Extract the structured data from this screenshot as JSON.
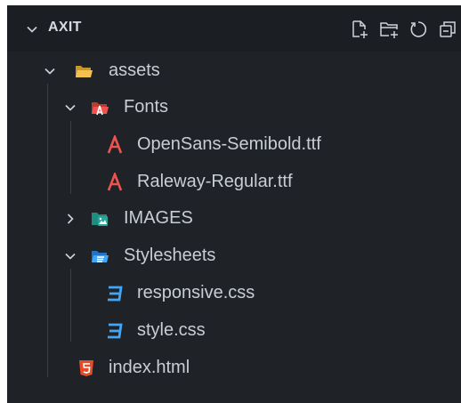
{
  "explorer": {
    "title": "AXIT",
    "actions": [
      {
        "name": "new-file-icon"
      },
      {
        "name": "new-folder-icon"
      },
      {
        "name": "refresh-icon"
      },
      {
        "name": "collapse-all-icon"
      }
    ]
  },
  "tree": {
    "assets": {
      "label": "assets",
      "icon": "folder-open-icon",
      "expanded": true
    },
    "fonts": {
      "label": "Fonts",
      "icon": "font-folder-icon",
      "expanded": true
    },
    "font_file_1": {
      "label": "OpenSans-Semibold.ttf",
      "icon": "font-file-icon"
    },
    "font_file_2": {
      "label": "Raleway-Regular.ttf",
      "icon": "font-file-icon"
    },
    "images": {
      "label": "IMAGES",
      "icon": "image-folder-icon",
      "expanded": false
    },
    "stylesheets": {
      "label": "Stylesheets",
      "icon": "css-folder-icon",
      "expanded": true
    },
    "css_file_1": {
      "label": "responsive.css",
      "icon": "css-file-icon"
    },
    "css_file_2": {
      "label": "style.css",
      "icon": "css-file-icon"
    },
    "html_file": {
      "label": "index.html",
      "icon": "html-file-icon"
    }
  },
  "colors": {
    "background": "#1f2227",
    "header": "#1b1e22",
    "text": "#c9cdd4",
    "folder_yellow": "#e9b53d",
    "font_red": "#ef5350",
    "css_blue": "#42a5f5",
    "html_orange": "#e44d26",
    "image_teal": "#26a69a"
  }
}
